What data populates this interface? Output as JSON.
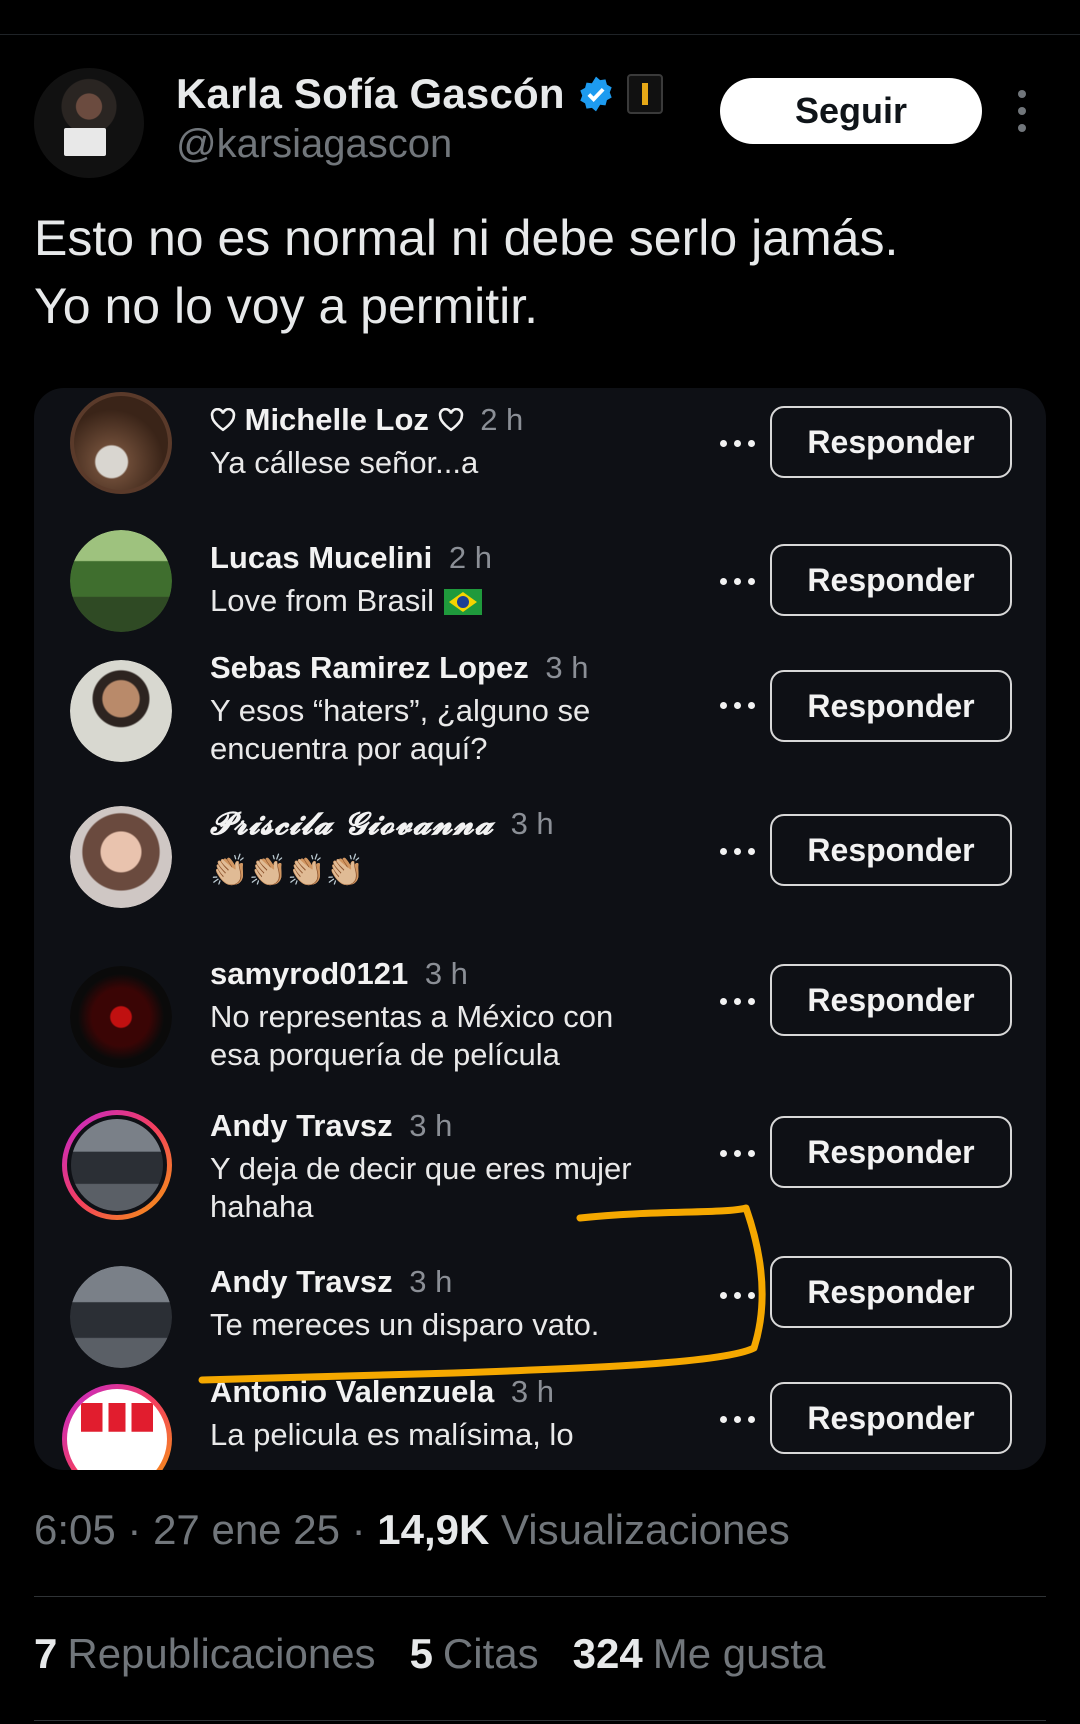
{
  "author": {
    "name": "Karla Sofía Gascón",
    "handle": "@karsiagascon",
    "follow_label": "Seguir"
  },
  "tweet": {
    "lines": [
      "Esto no es normal ni debe serlo jamás.",
      "Yo no lo voy a permitir."
    ]
  },
  "embedded_comments": {
    "reply_label": "Responder",
    "items": [
      {
        "name": "Michelle Loz",
        "time": "2 h",
        "text": "Ya cállese señor...a",
        "avatar_color": "#5a3a2a"
      },
      {
        "name": "Lucas Mucelini",
        "time": "2 h",
        "text": "Love from Brasil",
        "avatar_color": "#4f7a3a"
      },
      {
        "name": "Sebas Ramirez Lopez",
        "time": "3 h",
        "text": "Y esos “haters”, ¿alguno se encuentra por aquí?",
        "avatar_color": "#6a5447"
      },
      {
        "name": "𝓟𝓻𝓲𝓼𝓬𝓲𝓵𝓪 𝓖𝓲𝓸𝓿𝓪𝓷𝓷𝓪",
        "time": "3 h",
        "text": "👏🏼👏🏼👏🏼👏🏼",
        "avatar_color": "#a88273"
      },
      {
        "name": "samyrod0121",
        "time": "3 h",
        "text": "No representas a México con esa porquería de película",
        "avatar_color": "#2a0505"
      },
      {
        "name": "Andy Travsz",
        "time": "3 h",
        "text": "Y deja de decir que eres mujer hahaha",
        "avatar_color": "#3b3f46"
      },
      {
        "name": "Andy Travsz",
        "time": "3 h",
        "text": "Te mereces un disparo vato.",
        "avatar_color": "#3b3f46"
      },
      {
        "name": "Antonio Valenzuela",
        "time": "3 h",
        "text": "La pelicula es malísima, lo",
        "avatar_color": "#ffffff"
      }
    ]
  },
  "meta": {
    "time": "6:05",
    "date": "27 ene 25",
    "views_count": "14,9K",
    "views_label": "Visualizaciones"
  },
  "stats": {
    "reposts_count": "7",
    "reposts_label": "Republicaciones",
    "quotes_count": "5",
    "quotes_label": "Citas",
    "likes_count": "324",
    "likes_label": "Me gusta"
  },
  "colors": {
    "background": "#000000",
    "verified_blue": "#1d9bf0",
    "highlight_orange": "#f5a800"
  }
}
